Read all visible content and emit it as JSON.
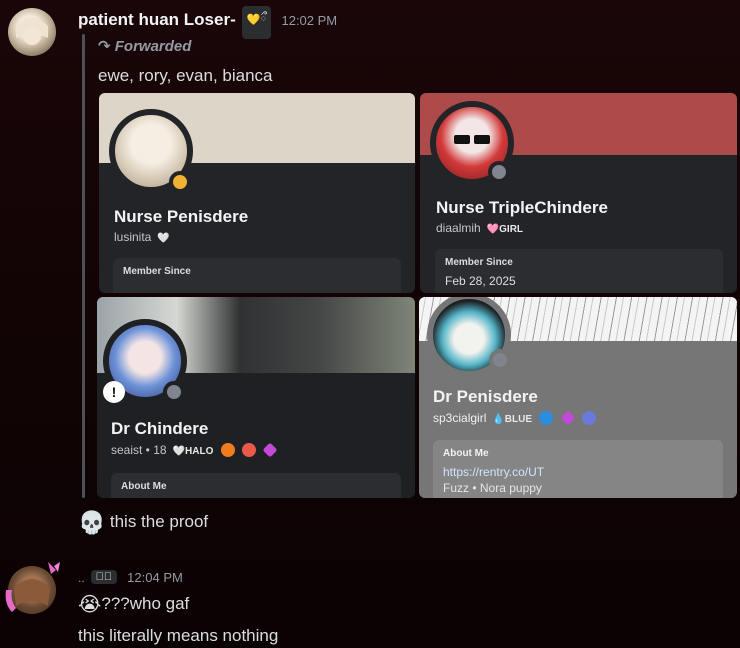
{
  "message1": {
    "username": "patient huan Loser-",
    "tag": "💛ྀ",
    "timestamp": "12:02 PM",
    "forwarded_label": "Forwarded",
    "forwarded_text": "ewe, rory, evan, bianca",
    "profiles": [
      {
        "display_name": "Nurse Penisdere",
        "username": "lusinita",
        "pill": "🤍",
        "section_title": "Member Since",
        "section_value": ""
      },
      {
        "display_name": "Nurse TripleChindere",
        "username": "diaalmih",
        "pill": "🩷GIRL",
        "section_title": "Member Since",
        "section_value": "Feb 28, 2025"
      },
      {
        "display_name": "Dr Chindere",
        "username": "seaist • 18",
        "pill": "🤍HALO",
        "section_title": "About Me",
        "section_value": ""
      },
      {
        "display_name": "Dr Penisdere",
        "username": "sp3cialgirl",
        "pill": "💧BLUE",
        "section_title": "About Me",
        "link": "https://rentry.co/UT",
        "section_value": "Fuzz • Nora puppy"
      }
    ]
  },
  "message1_followup": {
    "emoji": "💀",
    "text": "this the proof"
  },
  "message2": {
    "username": "..",
    "tag": "🗡ྀ",
    "timestamp": "12:04 PM",
    "line1_emoji": "😭",
    "line1_text": "???who gaf",
    "line2_text": "this literally means nothing"
  },
  "colors": {
    "card_bg": "#232428",
    "banner_1": "#ddd6c8",
    "banner_2": "#ad4a4a",
    "banner_4": "#767676",
    "link": "#00a8fc"
  }
}
